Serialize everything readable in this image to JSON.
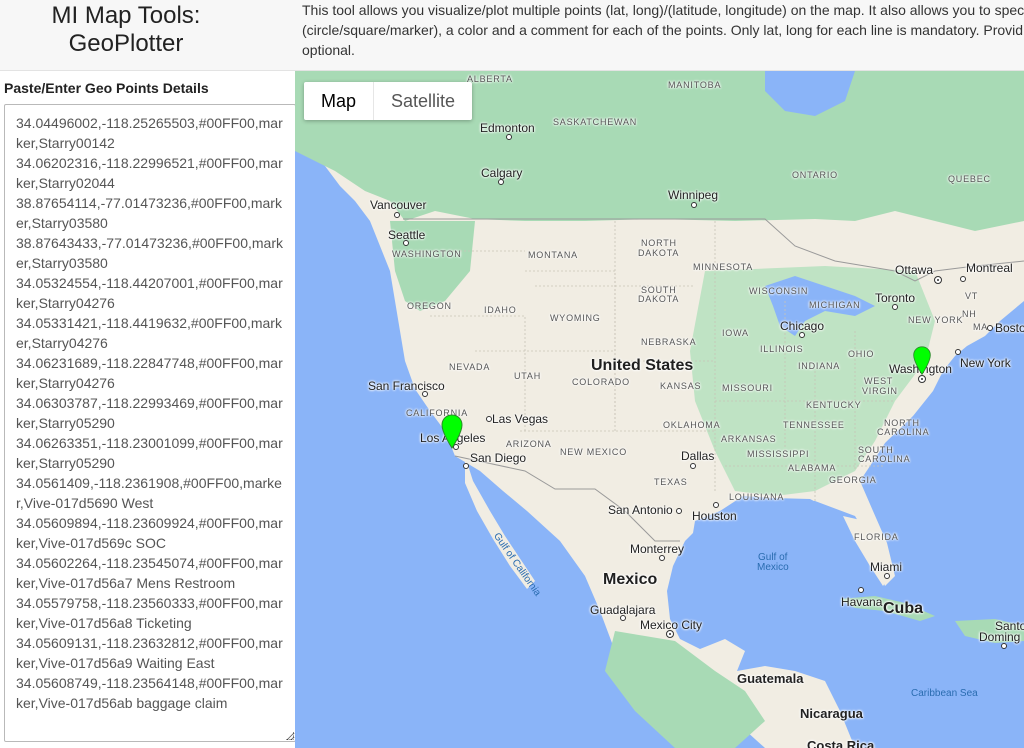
{
  "header": {
    "title_line1": "MI Map Tools:",
    "title_line2": "GeoPlotter",
    "description_lines": [
      "This tool allows you visualize/plot multiple points (lat, long)/(latitude, longitude) on the map. It also allows you to spec",
      "(circle/square/marker), a color and a comment for each of the points. Only lat, long for each line is mandatory. Provid",
      "optional."
    ]
  },
  "input_panel": {
    "label": "Paste/Enter Geo Points Details",
    "lines": [
      "34.04496002,-118.25265503,#00FF00,mar",
      "ker,Starry00142",
      "34.06202316,-118.22996521,#00FF00,mar",
      "ker,Starry02044",
      "38.87654114,-77.01473236,#00FF00,mark",
      "er,Starry03580",
      "38.87643433,-77.01473236,#00FF00,mark",
      "er,Starry03580",
      "34.05324554,-118.44207001,#00FF00,mar",
      "ker,Starry04276",
      "34.05331421,-118.4419632,#00FF00,mark",
      "er,Starry04276",
      "34.06231689,-118.22847748,#00FF00,mar",
      "ker,Starry04276",
      "34.06303787,-118.22993469,#00FF00,mar",
      "ker,Starry05290",
      "34.06263351,-118.23001099,#00FF00,mar",
      "ker,Starry05290",
      "34.0561409,-118.2361908,#00FF00,marke",
      "r,Vive-017d5690 West",
      "34.05609894,-118.23609924,#00FF00,mar",
      "ker,Vive-017d569c SOC",
      "34.05602264,-118.23545074,#00FF00,mar",
      "ker,Vive-017d56a7 Mens Restroom",
      "34.05579758,-118.23560333,#00FF00,mar",
      "ker,Vive-017d56a8 Ticketing",
      "34.05609131,-118.23632812,#00FF00,mar",
      "ker,Vive-017d56a9 Waiting East",
      "34.05608749,-118.23564148,#00FF00,mar",
      "ker,Vive-017d56ab baggage claim"
    ]
  },
  "map": {
    "type_buttons": {
      "map": "Map",
      "satellite": "Satellite"
    },
    "active_type": "Map",
    "marker_color": "#00FF00",
    "colors": {
      "water": "#8ab4f8",
      "land": "#f1ede3",
      "green": "#a8dab5",
      "forest": "#bfe3c4"
    },
    "states": {
      "alberta": "ALBERTA",
      "manitoba": "MANITOBA",
      "saskatchewan": "SASKATCHEWAN",
      "ontario": "ONTARIO",
      "quebec": "QUEBEC",
      "washington": "WASHINGTON",
      "montana": "MONTANA",
      "north_dakota_1": "NORTH",
      "north_dakota_2": "DAKOTA",
      "minnesota": "MINNESOTA",
      "oregon": "OREGON",
      "idaho": "IDAHO",
      "wyoming": "WYOMING",
      "south_dakota_1": "SOUTH",
      "south_dakota_2": "DAKOTA",
      "wisconsin": "WISCONSIN",
      "michigan": "MICHIGAN",
      "new_york": "NEW YORK",
      "vt": "VT",
      "nh": "NH",
      "ma": "MA",
      "pa": "PE",
      "iowa": "IOWA",
      "nebraska": "NEBRASKA",
      "nevada": "NEVADA",
      "utah": "UTAH",
      "colorado": "COLORADO",
      "illinois": "ILLINOIS",
      "indiana": "INDIANA",
      "ohio": "OHIO",
      "kansas": "KANSAS",
      "missouri": "MISSOURI",
      "west_1": "WEST",
      "west_2": "VIRGIN",
      "kentucky": "KENTUCKY",
      "california": "CALIFORNIA",
      "arizona": "ARIZONA",
      "oklahoma": "OKLAHOMA",
      "tennessee": "TENNESSEE",
      "north_carolina_1": "NORTH",
      "north_carolina_2": "CAROLINA",
      "south_carolina_1": "SOUTH",
      "south_carolina_2": "CAROLINA",
      "new_mexico": "NEW MEXICO",
      "arkansas": "ARKANSAS",
      "mississippi": "MISSISSIPPI",
      "alabama": "ALABAMA",
      "georgia": "GEORGIA",
      "texas": "TEXAS",
      "louisiana": "LOUISIANA",
      "florida": "FLORIDA"
    },
    "cities": {
      "edmonton": "Edmonton",
      "calgary": "Calgary",
      "winnipeg": "Winnipeg",
      "vancouver": "Vancouver",
      "seattle": "Seattle",
      "ottawa": "Ottawa",
      "montreal": "Montreal",
      "toronto": "Toronto",
      "boston": "Bosto",
      "chicago": "Chicago",
      "new_york": "New York",
      "washington": "Washington",
      "san_francisco": "San Francisco",
      "las_vegas": "Las Vegas",
      "los_angeles": "Los Angeles",
      "san_diego": "San Diego",
      "dallas": "Dallas",
      "san_antonio": "San Antonio",
      "houston": "Houston",
      "monterrey": "Monterrey",
      "miami": "Miami",
      "havana": "Havana",
      "guadalajara": "Guadalajara",
      "mexico_city": "Mexico City",
      "guatemala": "Guatemala",
      "nicaragua": "Nicaragua",
      "costa_rica": "Costa Rica",
      "santo_1": "Santo",
      "santo_2": "Doming"
    },
    "countries": {
      "us": "United States",
      "mexico": "Mexico",
      "cuba": "Cuba"
    },
    "water_labels": {
      "gulf_california": "Gulf of California",
      "gulf_mexico_1": "Gulf of",
      "gulf_mexico_2": "Mexico",
      "caribbean": "Caribbean Sea"
    }
  }
}
